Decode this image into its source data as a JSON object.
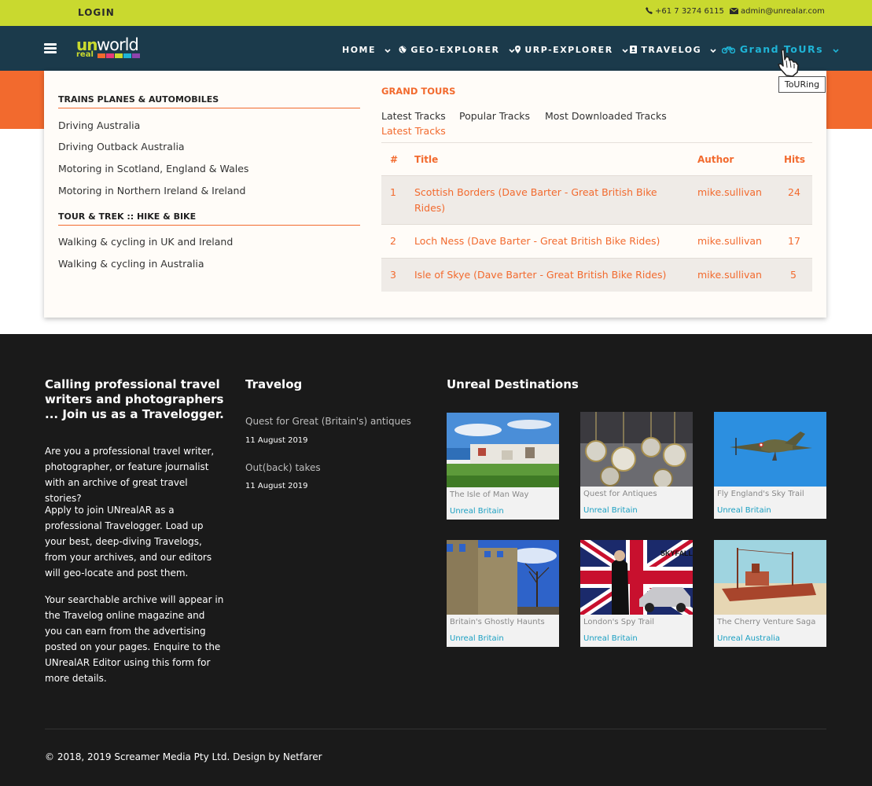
{
  "topbar": {
    "login": "LOGIN",
    "phone": "+61 7 3274 6115",
    "email": "admin@unrealar.com"
  },
  "logo": {
    "un": "un",
    "world": "world",
    "real": "real"
  },
  "nav": {
    "items": [
      {
        "label": "HOME"
      },
      {
        "label": "GEO-EXPLORER"
      },
      {
        "label": "URP-EXPLORER"
      },
      {
        "label": "TRAVELOG"
      },
      {
        "label": "Grand ToURs"
      }
    ],
    "tooltip": "ToURing"
  },
  "mega": {
    "sections": [
      {
        "title": "TRAINS PLANES & AUTOMOBILES",
        "links": [
          "Driving Australia",
          "Driving Outback Australia",
          "Motoring in Scotland, England & Wales",
          "Motoring in Northern Ireland & Ireland"
        ]
      },
      {
        "title": "TOUR & TREK :: HIKE & BIKE",
        "links": [
          "Walking & cycling in UK and Ireland",
          "Walking & cycling in Australia"
        ]
      }
    ],
    "grand_tours": {
      "title": "GRAND TOURS",
      "tabs": [
        "Latest Tracks",
        "Popular Tracks",
        "Most Downloaded Tracks"
      ],
      "active_tab": "Latest Tracks",
      "columns": [
        "#",
        "Title",
        "Author",
        "Hits"
      ],
      "rows": [
        {
          "num": "1",
          "title": "Scottish Borders (Dave Barter - Great British Bike Rides)",
          "author": "mike.sullivan",
          "hits": "24"
        },
        {
          "num": "2",
          "title": "Loch Ness (Dave Barter - Great British Bike Rides)",
          "author": "mike.sullivan",
          "hits": "17"
        },
        {
          "num": "3",
          "title": "Isle of Skye (Dave Barter - Great British Bike Rides)",
          "author": "mike.sullivan",
          "hits": "5"
        }
      ]
    }
  },
  "footer": {
    "col1": {
      "heading": "Calling professional travel writers and photographers ... Join us as a Travelogger.",
      "paragraphs": [
        "Are you a professional travel writer, photographer, or feature journalist with an archive of great travel stories?",
        "Apply to join UNrealAR as a professional Travelogger. Load up your best, deep-diving Travelogs, from your archives, and our editors will geo-locate and post them.",
        "Your searchable archive will appear in the Travelog online magazine and you can earn from the advertising posted on your pages. Enquire to the UNrealAR Editor using this form for more details."
      ]
    },
    "col2": {
      "heading": "Travelog",
      "posts": [
        {
          "title": "Quest for Great (Britain's) antiques",
          "date": "11 August 2019"
        },
        {
          "title": "Out(back) takes",
          "date": "11 August 2019"
        }
      ]
    },
    "col3": {
      "heading": "Unreal Destinations",
      "cards": [
        {
          "caption": "The Isle of Man Way",
          "region": "Unreal Britain"
        },
        {
          "caption": "Quest for Antiques",
          "region": "Unreal Britain"
        },
        {
          "caption": "Fly England's Sky Trail",
          "region": "Unreal Britain"
        },
        {
          "caption": "Britain's Ghostly Haunts",
          "region": "Unreal Britain"
        },
        {
          "caption": "London's Spy Trail",
          "region": "Unreal Britain"
        },
        {
          "caption": "The Cherry Venture Saga",
          "region": "Unreal Australia"
        }
      ]
    },
    "copyright": "© 2018, 2019 Screamer Media Pty Ltd. Design by Netfarer"
  },
  "colors": {
    "accent_green": "#c9d92f",
    "nav_bg": "#1b3a4b",
    "accent_orange": "#f26a2e",
    "accent_cyan": "#1fb4d6",
    "footer_bg": "#1a1a1a"
  }
}
